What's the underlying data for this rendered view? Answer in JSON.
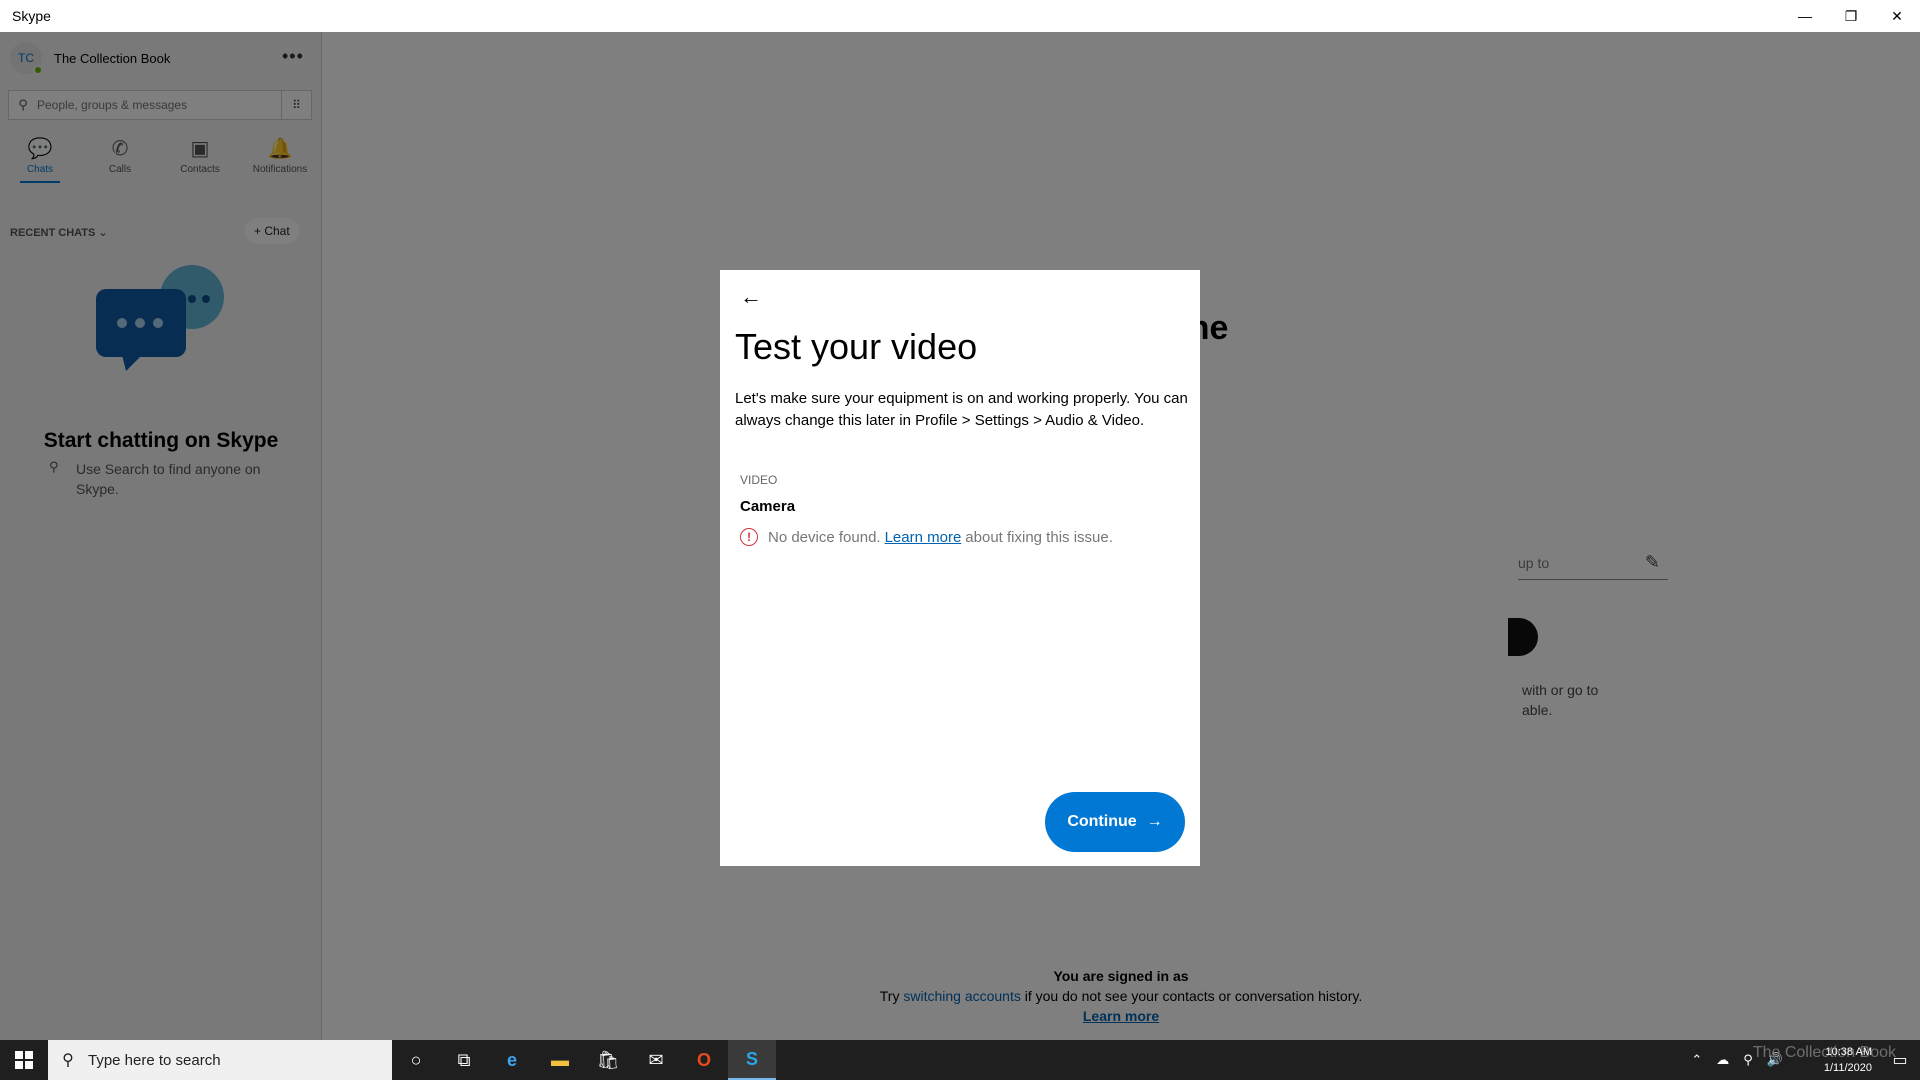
{
  "window": {
    "title": "Skype",
    "controls": {
      "minimize": "—",
      "restore": "❐",
      "close": "✕"
    }
  },
  "sidebar": {
    "profile": {
      "initials": "TC",
      "name": "The Collection Book",
      "more": "•••"
    },
    "search": {
      "placeholder": "People, groups & messages"
    },
    "nav": [
      {
        "label": "Chats",
        "icon": "chat-icon",
        "glyph": "💬"
      },
      {
        "label": "Calls",
        "icon": "phone-icon",
        "glyph": "✆"
      },
      {
        "label": "Contacts",
        "icon": "contacts-icon",
        "glyph": "▣"
      },
      {
        "label": "Notifications",
        "icon": "bell-icon",
        "glyph": "🔔"
      }
    ],
    "recent_chats_label": "RECENT CHATS",
    "new_chat_label": "+ Chat",
    "empty_title": "Start chatting on Skype",
    "empty_hint": "Use Search to find anyone on Skype."
  },
  "main": {
    "heading_fragment": "The",
    "mood_fragment": "up to",
    "text_line1": "with or go to",
    "text_line2": "able.",
    "signed_in_title": "You are signed in as",
    "signed_in_try": "Try",
    "signed_in_link": "switching accounts",
    "signed_in_rest": "if you do not see your contacts or conversation history.",
    "learn_more": "Learn more"
  },
  "modal": {
    "title": "Test your video",
    "description": "Let's make sure your equipment is on and working properly. You can always change this later in Profile > Settings > Audio & Video.",
    "section_label": "VIDEO",
    "camera_label": "Camera",
    "error_prefix": "No device found.",
    "error_link": "Learn more",
    "error_suffix": "about fixing this issue.",
    "continue_label": "Continue",
    "continue_arrow": "→",
    "back_arrow": "←"
  },
  "taskbar": {
    "search_placeholder": "Type here to search",
    "time": "10:38 AM",
    "date": "1/11/2020",
    "watermark": "The Collection Book"
  },
  "colors": {
    "accent": "#0078d4",
    "error": "#d13438",
    "link": "#0063b1"
  }
}
